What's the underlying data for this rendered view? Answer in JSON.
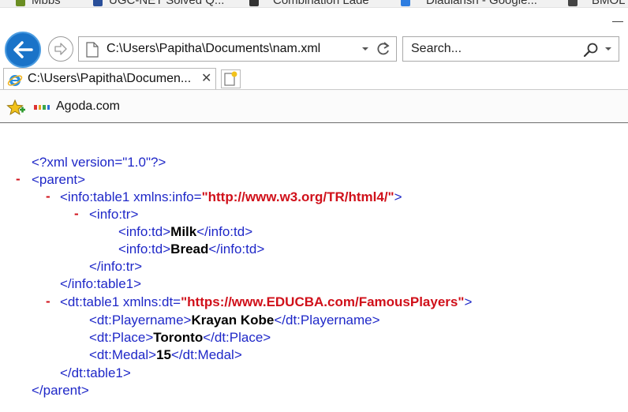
{
  "bookmarks_top": [
    {
      "label": "Mbbs"
    },
    {
      "label": "UGC-NET Solved Q..."
    },
    {
      "label": "Combination Lade"
    },
    {
      "label": "Diaulansh - Google..."
    },
    {
      "label": "BMOL"
    }
  ],
  "nav": {
    "back_icon": "back-arrow-icon",
    "forward_icon": "forward-arrow-icon"
  },
  "address_bar": {
    "url": "C:\\Users\\Papitha\\Documents\\nam.xml"
  },
  "search_box": {
    "placeholder": "Search..."
  },
  "tab": {
    "title": "C:\\Users\\Papitha\\Documen...",
    "close": "✕"
  },
  "favorites": {
    "link": "Agoda.com"
  },
  "xml": {
    "decl": "<?xml version=\"1.0\"?>",
    "collapse_marker": "-",
    "parent_open": "<parent>",
    "table1_open_prefix": "<info:table1 xmlns:info=",
    "table1_ns": "\"http://www.w3.org/TR/html4/\"",
    "tag_close": ">",
    "tr_open": "<info:tr>",
    "td_open": "<info:td>",
    "td_close": "</info:td>",
    "td1_value": "Milk",
    "td2_value": "Bread",
    "tr_close": "</info:tr>",
    "table1_close": "</info:table1>",
    "dt_table_open_prefix": "<dt:table1 xmlns:dt=",
    "dt_table_ns": "\"https://www.EDUCBA.com/FamousPlayers\"",
    "playername_open": "<dt:Playername>",
    "playername_value": "Krayan Kobe",
    "playername_close": "</dt:Playername>",
    "place_open": "<dt:Place>",
    "place_value": "Toronto",
    "place_close": "</dt:Place>",
    "medal_open": "<dt:Medal>",
    "medal_value": "15",
    "medal_close": "</dt:Medal>",
    "dt_table_close": "</dt:table1>",
    "parent_close": "</parent>"
  },
  "colors": {
    "tag_blue": "#1f28c8",
    "attr_red": "#d0101a",
    "back_button_blue": "#1a73c8"
  }
}
